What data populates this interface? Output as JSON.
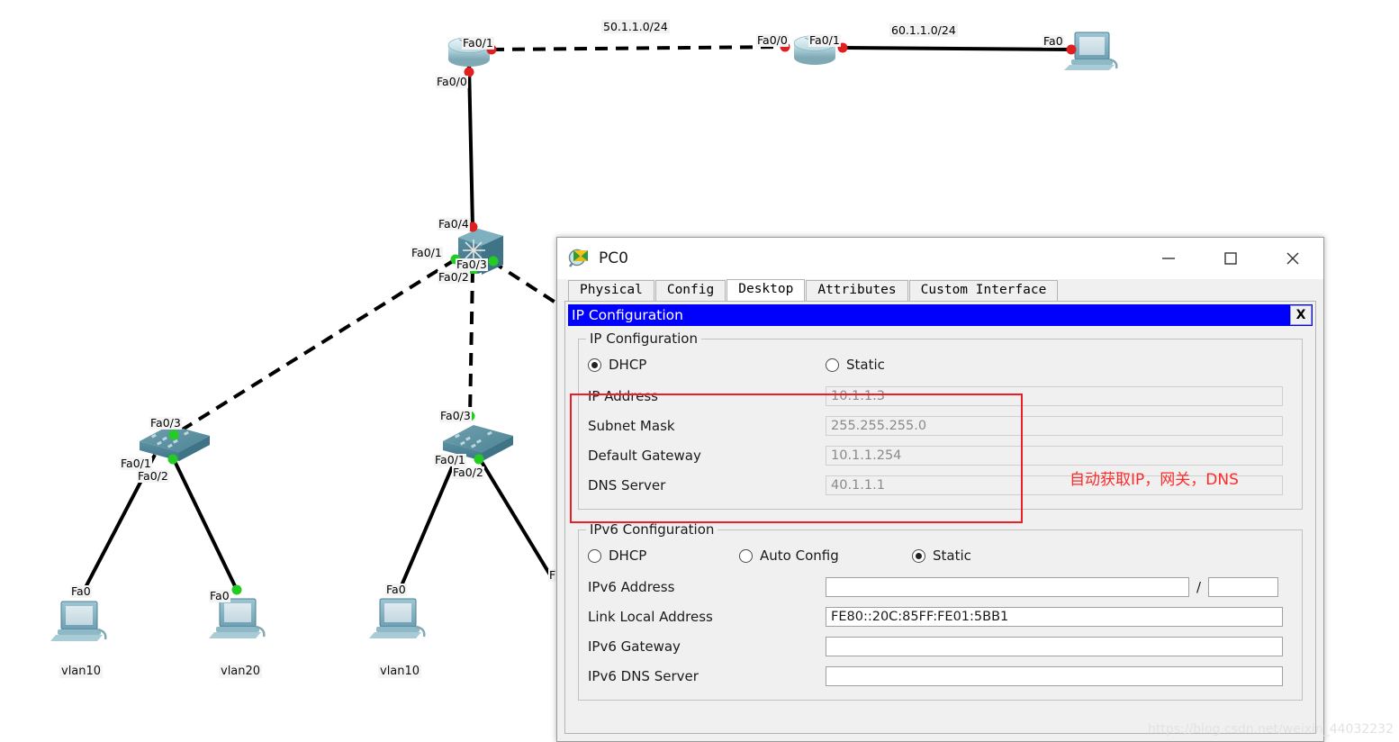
{
  "topology": {
    "networks": [
      {
        "label": "50.1.1.0/24"
      },
      {
        "label": "60.1.1.0/24"
      }
    ],
    "ports": {
      "r1_fa01": "Fa0/1",
      "r1_fa00": "Fa0/0",
      "r2_fa00": "Fa0/0",
      "r2_fa01": "Fa0/1",
      "pc_right_fa0": "Fa0",
      "sw_core_fa04": "Fa0/4",
      "sw_core_fa01": "Fa0/1",
      "sw_core_fa03": "Fa0/3",
      "sw_core_fa02": "Fa0/2",
      "sw_left_fa03": "Fa0/3",
      "sw_left_fa01": "Fa0/1",
      "sw_left_fa02": "Fa0/2",
      "sw_right_fa03": "Fa0/3",
      "sw_right_fa01": "Fa0/1",
      "sw_right_fa02": "Fa0/2",
      "pc1_fa0": "Fa0",
      "pc2_fa0": "Fa0",
      "pc3_fa0": "Fa0",
      "pc4_fa0_partial": "F"
    },
    "device_labels": {
      "pc1": "vlan10",
      "pc2": "vlan20",
      "pc3": "vlan10"
    }
  },
  "dialog": {
    "title": "PC0",
    "icon": "pc-magnifier-icon",
    "window_buttons": {
      "minimize": "—",
      "maximize": "□",
      "close": "✕"
    },
    "tabs": [
      {
        "label": "Physical",
        "active": false
      },
      {
        "label": "Config",
        "active": false
      },
      {
        "label": "Desktop",
        "active": true
      },
      {
        "label": "Attributes",
        "active": false
      },
      {
        "label": "Custom Interface",
        "active": false
      }
    ],
    "panel": {
      "header_title": "IP Configuration",
      "header_close": "X",
      "ipv4": {
        "legend": "IP Configuration",
        "mode_options": [
          {
            "label": "DHCP",
            "selected": true
          },
          {
            "label": "Static",
            "selected": false
          }
        ],
        "fields": [
          {
            "label": "IP Address",
            "value": "10.1.1.3"
          },
          {
            "label": "Subnet Mask",
            "value": "255.255.255.0"
          },
          {
            "label": "Default Gateway",
            "value": "10.1.1.254"
          },
          {
            "label": "DNS Server",
            "value": "40.1.1.1"
          }
        ]
      },
      "ipv6": {
        "legend": "IPv6 Configuration",
        "mode_options": [
          {
            "label": "DHCP",
            "selected": false
          },
          {
            "label": "Auto Config",
            "selected": false
          },
          {
            "label": "Static",
            "selected": true
          }
        ],
        "prefix_separator": "/",
        "fields": [
          {
            "label": "IPv6 Address",
            "value": ""
          },
          {
            "label": "Link Local Address",
            "value": "FE80::20C:85FF:FE01:5BB1"
          },
          {
            "label": "IPv6 Gateway",
            "value": ""
          },
          {
            "label": "IPv6 DNS Server",
            "value": ""
          }
        ],
        "prefix_value": ""
      }
    }
  },
  "annotation": {
    "text": "自动获取IP，网关，DNS",
    "color": "#ff2a2a"
  },
  "watermark": {
    "text": "https://blog.csdn.net/weixin_44032232"
  },
  "colors": {
    "header_blue": "#0000ff",
    "annotation_red": "#ee1c25",
    "link_up": "#22cc22",
    "link_down": "#ee2222",
    "panel_bg": "#f0f0f0"
  }
}
